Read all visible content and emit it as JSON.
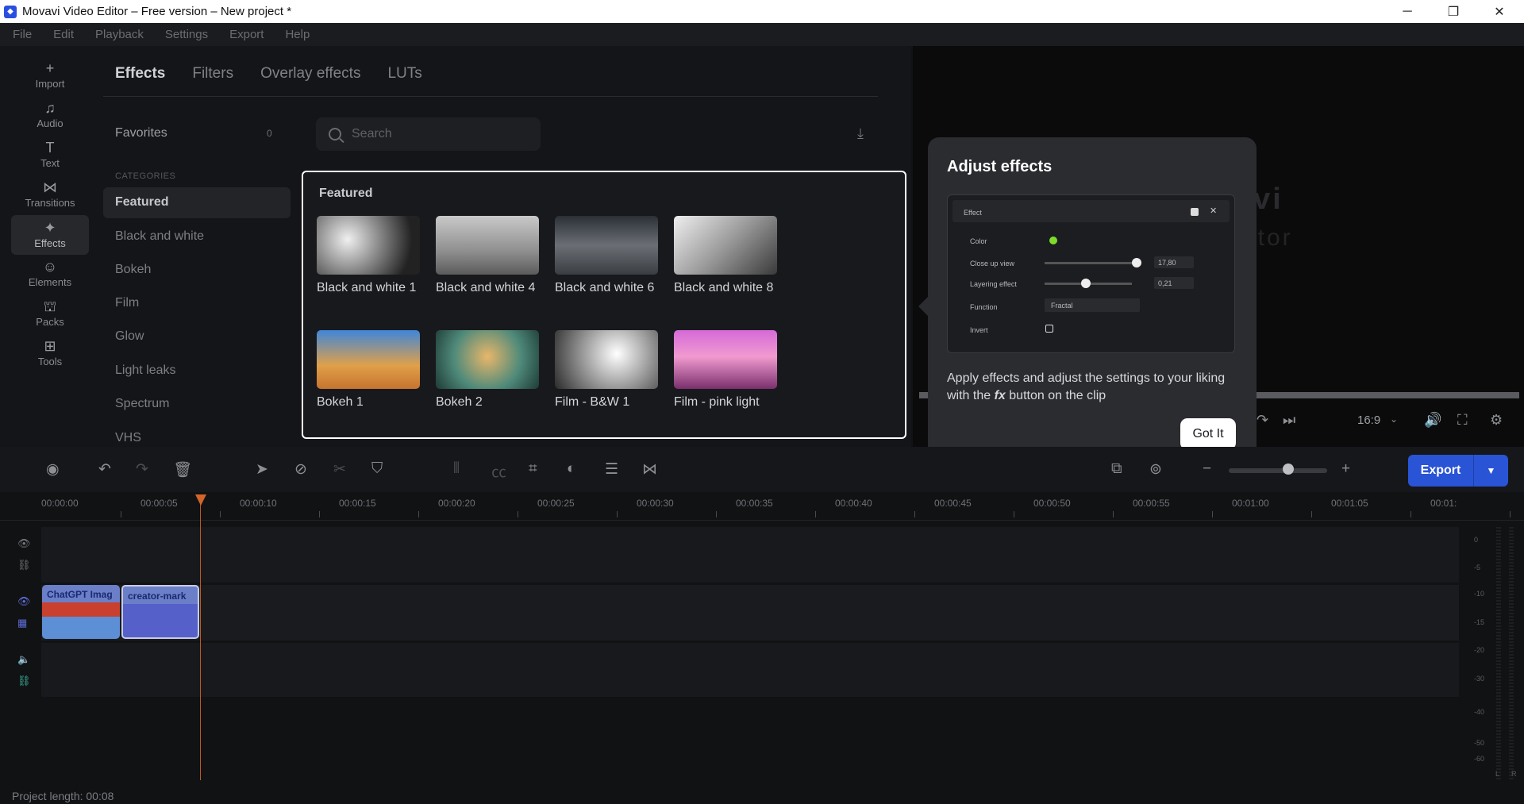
{
  "window": {
    "title": "Movavi Video Editor – Free version – New project *",
    "controls": [
      "minimize",
      "restore",
      "close"
    ]
  },
  "menu": [
    "File",
    "Edit",
    "Playback",
    "Settings",
    "Export",
    "Help"
  ],
  "sidebar": [
    {
      "label": "Import",
      "icon": "plus-icon",
      "glyph": "+"
    },
    {
      "label": "Audio",
      "icon": "music-note-icon",
      "glyph": "♫"
    },
    {
      "label": "Text",
      "icon": "text-icon",
      "glyph": "T"
    },
    {
      "label": "Transitions",
      "icon": "transitions-icon",
      "glyph": "⋈"
    },
    {
      "label": "Effects",
      "icon": "effects-icon",
      "glyph": "✦",
      "active": true
    },
    {
      "label": "Elements",
      "icon": "elements-icon",
      "glyph": "☺"
    },
    {
      "label": "Packs",
      "icon": "packs-icon",
      "glyph": "⛫"
    },
    {
      "label": "Tools",
      "icon": "tools-icon",
      "glyph": "⊞"
    }
  ],
  "tabs": [
    {
      "label": "Effects",
      "active": true
    },
    {
      "label": "Filters"
    },
    {
      "label": "Overlay effects"
    },
    {
      "label": "LUTs"
    }
  ],
  "favorites": {
    "label": "Favorites",
    "count": "0"
  },
  "categories": {
    "heading": "CATEGORIES",
    "items": [
      "Featured",
      "Black and white",
      "Bokeh",
      "Film",
      "Glow",
      "Light leaks",
      "Spectrum",
      "VHS"
    ]
  },
  "search": {
    "placeholder": "Search"
  },
  "featured": {
    "title": "Featured",
    "items": [
      {
        "label": "Black and white 1"
      },
      {
        "label": "Black and white 4"
      },
      {
        "label": "Black and white 6"
      },
      {
        "label": "Black and white 8"
      },
      {
        "label": "Bokeh 1"
      },
      {
        "label": "Bokeh 2"
      },
      {
        "label": "Film - B&W 1"
      },
      {
        "label": "Film - pink light"
      }
    ]
  },
  "popup": {
    "title": "Adjust effects",
    "text_before": "Apply effects and adjust the settings to your liking with the ",
    "fx": "fx",
    "text_after": " button on the clip",
    "button": "Got It",
    "screenshot": {
      "header": "Effect",
      "rows": [
        {
          "label": "Color"
        },
        {
          "label": "Close up view",
          "value": "17,80"
        },
        {
          "label": "Layering effect",
          "value": "0,21"
        },
        {
          "label": "Function",
          "value": "Fractal"
        },
        {
          "label": "Invert"
        }
      ]
    }
  },
  "player": {
    "watermark_1": "avi",
    "watermark_2": "itor",
    "aspect_ratio": "16:9"
  },
  "export": {
    "label": "Export"
  },
  "timeline": {
    "ticks": [
      "00:00:00",
      "00:00:05",
      "00:00:10",
      "00:00:15",
      "00:00:20",
      "00:00:25",
      "00:00:30",
      "00:00:35",
      "00:00:40",
      "00:00:45",
      "00:00:50",
      "00:00:55",
      "00:01:00",
      "00:01:05",
      "00:01:"
    ],
    "clips": [
      {
        "label": "ChatGPT Imag"
      },
      {
        "label": "creator-mark"
      }
    ],
    "meter_labels": [
      "0",
      "-5",
      "-10",
      "-15",
      "-20",
      "-30",
      "-40",
      "-50",
      "-60"
    ],
    "meter_channels": [
      "L",
      "R"
    ]
  },
  "status": {
    "project_length": "Project length: 00:08"
  },
  "colors": {
    "accent": "#2a54d6",
    "playhead": "#d2662a",
    "popup_bg": "#2b2c30"
  }
}
